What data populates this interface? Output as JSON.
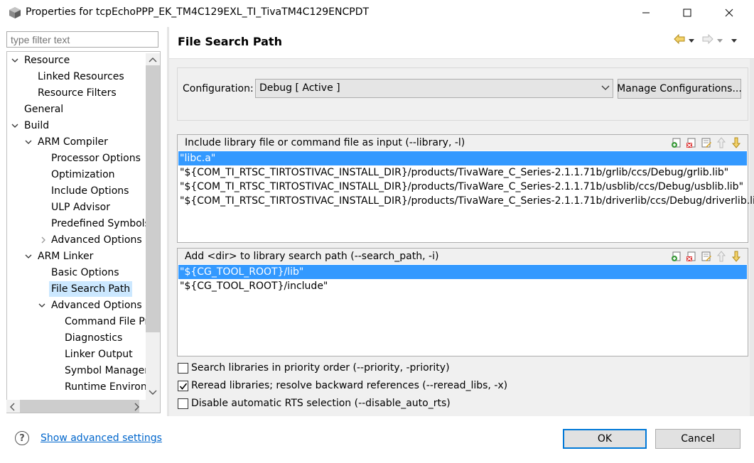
{
  "window": {
    "title": "Properties for tcpEchoPPP_EK_TM4C129EXL_TI_TivaTM4C129ENCPDT",
    "icons": [
      "app-icon",
      "minimize-icon",
      "maximize-icon",
      "close-icon"
    ]
  },
  "sidebar": {
    "filter_placeholder": "type filter text",
    "tree": [
      {
        "label": "Resource",
        "expanded": true
      },
      {
        "label": "Linked Resources"
      },
      {
        "label": "Resource Filters"
      },
      {
        "label": "General"
      },
      {
        "label": "Build",
        "expanded": true
      },
      {
        "label": "ARM Compiler",
        "expanded": true
      },
      {
        "label": "Processor Options"
      },
      {
        "label": "Optimization"
      },
      {
        "label": "Include Options"
      },
      {
        "label": "ULP Advisor"
      },
      {
        "label": "Predefined Symbols"
      },
      {
        "label": "Advanced Options",
        "expanded": false
      },
      {
        "label": "ARM Linker",
        "expanded": true
      },
      {
        "label": "Basic Options"
      },
      {
        "label": "File Search Path",
        "selected": true
      },
      {
        "label": "Advanced Options",
        "expanded": true
      },
      {
        "label": "Command File Pr"
      },
      {
        "label": "Diagnostics"
      },
      {
        "label": "Linker Output"
      },
      {
        "label": "Symbol Manager"
      },
      {
        "label": "Runtime Environn"
      }
    ]
  },
  "page": {
    "title": "File Search Path",
    "nav_icons": [
      "back-arrow-icon",
      "dropdown-icon",
      "forward-arrow-icon",
      "dropdown-icon",
      "view-menu-icon"
    ]
  },
  "configuration": {
    "label": "Configuration:",
    "selected": "Debug  [ Active ]",
    "manage_label": "Manage Configurations..."
  },
  "library_list": {
    "header": "Include library file or command file as input (--library, -l)",
    "items": [
      "\"libc.a\"",
      "\"${COM_TI_RTSC_TIRTOSTIVAC_INSTALL_DIR}/products/TivaWare_C_Series-2.1.1.71b/grlib/ccs/Debug/grlib.lib\"",
      "\"${COM_TI_RTSC_TIRTOSTIVAC_INSTALL_DIR}/products/TivaWare_C_Series-2.1.1.71b/usblib/ccs/Debug/usblib.lib\"",
      "\"${COM_TI_RTSC_TIRTOSTIVAC_INSTALL_DIR}/products/TivaWare_C_Series-2.1.1.71b/driverlib/ccs/Debug/driverlib.lib\""
    ],
    "selected_index": 0
  },
  "dir_list": {
    "header": "Add <dir> to library search path (--search_path, -i)",
    "items": [
      "\"${CG_TOOL_ROOT}/lib\"",
      "\"${CG_TOOL_ROOT}/include\""
    ],
    "selected_index": 0
  },
  "list_tools": [
    "add-icon",
    "delete-icon",
    "edit-icon",
    "move-up-icon",
    "move-down-icon"
  ],
  "options": [
    {
      "label": "Search libraries in priority order (--priority, -priority)",
      "checked": false
    },
    {
      "label": "Reread libraries; resolve backward references (--reread_libs, -x)",
      "checked": true
    },
    {
      "label": "Disable automatic RTS selection (--disable_auto_rts)",
      "checked": false
    }
  ],
  "footer": {
    "help_icon": "help-icon",
    "advanced_link": "Show advanced settings",
    "ok_label": "OK",
    "cancel_label": "Cancel"
  },
  "colors": {
    "selection": "#3399ff",
    "tree_selection": "#cce8ff",
    "link": "#0066cc",
    "default_button_border": "#0078d7"
  }
}
